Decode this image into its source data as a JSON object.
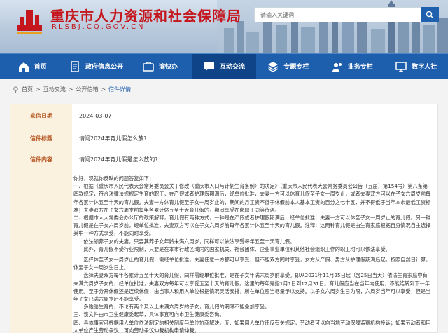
{
  "header": {
    "site_name": "重庆市人力资源和社会保障局",
    "site_url": "RLSBJ.CQ.GOV.CN",
    "search_placeholder": "请输入关键词"
  },
  "nav": {
    "items": [
      {
        "label": "首页",
        "icon": "home-icon"
      },
      {
        "label": "政府信息公开",
        "icon": "document-icon"
      },
      {
        "label": "渝快办",
        "icon": "service-icon"
      },
      {
        "label": "互动交流",
        "icon": "chat-icon",
        "active": true
      },
      {
        "label": "专题专栏",
        "icon": "layers-icon"
      },
      {
        "label": "业务专栏",
        "icon": "briefcase-icon"
      },
      {
        "label": "数字人社",
        "icon": "screen-icon"
      }
    ]
  },
  "breadcrumb": [
    "首页",
    "互动交流",
    "公开信箱",
    "信件详情"
  ],
  "letter": {
    "date_label": "来信日期",
    "date": "2024-03-07",
    "title_label": "信件标题",
    "title": "请问2024年育儿假怎么放?",
    "content_label": "信件内容",
    "content": "请问2024年育儿假是怎么放的?",
    "reply": [
      {
        "text": "你好，现就你反映的问题答复如下：",
        "indent": false
      },
      {
        "text": "一、根据《重庆市人民代表大会常务委员会关于修改〈重庆市人口与计划生育条例〉的决定》（重庆市人民代表大会常务委员会公告〔五届〕第154号）第八条第四款规定，符合法律法规规定生育的职工，在产假或者护理假期满后，经单位批准，夫妻一方可以休育儿假至子女一周岁止，或者夫妻双方可以在子女六周岁前每年各累计休五至十天的育儿假。夫妻一方休育儿假至子女一周岁止的，期间的月工资不低于休假前本人基本工资的百分之七十五，并不得低于当年本市最低工资标准；夫妻双方在子女六周岁前每年各累计休五至十天育儿假的，期间享受在岗职工同等待遇。",
        "indent": false
      },
      {
        "text": "二、根据市人大常委会办公厅的政策解释，育儿假有两种方式，一种是在产假或者护理假期满后，经单位批准，夫妻一方可以休至子女一周岁止的育儿假。另一种育儿假是在子女六周岁前，经单位批准，夫妻双方可以在子女六周岁前每年各累计休五至十天的育儿假。注释：这两种育儿假是由生育家庭根据自身情况自主选择其中一种方式享受，不能同时享受。",
        "indent": false
      },
      {
        "text": "依法领养子女的夫妻，只要其养子女年龄未满六周岁，同样可以依法享受每年五至十天育儿假。",
        "indent": true
      },
      {
        "text": "此外，育儿假不受行业限制，只要是在本市行政区域内的国家机关、社会团体、企业事业单位和其他社会组织工作的职工均可以依法享受。",
        "indent": true
      },
      {
        "text": "选择休至子女一周岁止的育儿假，需经单位批准，夫妻任意一方都可以享受，但不能双方同时享受，女方从产假、男方从护理假期满后起，按照自然日计算，休至子女一周岁生日止。",
        "indent": true
      },
      {
        "text": "选择夫妻双方每年各累计五至十天的育儿假，同样需经单位批准，是在子女年满六周岁前享受。即从2021年11月25日起（含25日当天）依法生育家庭中有未满六周岁子女的，经单位批准，夫妻双方每年可以享受五至十天的育儿假。这里的每年是指1月1日到12月31日。育儿假应当在当年内使用，不能结转到下一年使用。至于分开休假还是连续休假，由当事人和用人单位根据情况灵活安排，所在单位应当尽量予以支持。以子女六周岁生日为限，六周岁当年可以享受，但是当年子女已满六周岁后不能享受。",
        "indent": true
      },
      {
        "text": "多胞胎生育的，不论有两个及以上未满六周岁的子女，育儿假的期限不能叠加享受。",
        "indent": true
      },
      {
        "text": "三、该文件由市卫生健康委起草，具体事宜可向市卫生健康委咨询。",
        "indent": false
      },
      {
        "text": "四、具体事宜可根据用人单位依法制定的相关制度与单位协商解决。五、如果用人单位违反有关规定，劳动者可以向当地劳动保障监察机构投诉；如果劳动者和用人单位产生劳动争议，可向劳动争议仲裁机构申请仲裁。",
        "indent": false
      }
    ]
  },
  "colors": {
    "brand_red": "#c4161c",
    "nav_blue": "#1d5ead",
    "label_bg": "#fbf1df",
    "label_text": "#b05018"
  }
}
